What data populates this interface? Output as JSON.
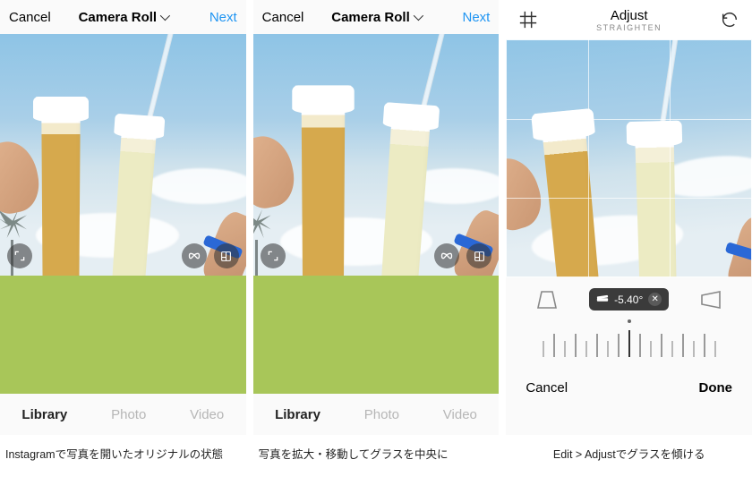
{
  "colors": {
    "accent": "#2095f2",
    "thumb_bg": "#a8c659",
    "icon_dark": "#3b3b3b"
  },
  "panels": [
    {
      "topbar": {
        "cancel": "Cancel",
        "title": "Camera Roll",
        "next": "Next"
      },
      "overlay": {
        "expand": "expand-icon",
        "infinity": "infinity-icon",
        "collage": "collage-icon"
      },
      "tabs": {
        "library": "Library",
        "photo": "Photo",
        "video": "Video",
        "active": "library"
      },
      "caption": "Instagramで写真を開いたオリジナルの状態"
    },
    {
      "topbar": {
        "cancel": "Cancel",
        "title": "Camera Roll",
        "next": "Next"
      },
      "overlay": {
        "expand": "expand-icon",
        "infinity": "infinity-icon",
        "collage": "collage-icon"
      },
      "tabs": {
        "library": "Library",
        "photo": "Photo",
        "video": "Video",
        "active": "library"
      },
      "caption": "写真を拡大・移動してグラスを中央に"
    },
    {
      "topbar": {
        "title": "Adjust",
        "subtitle": "STRAIGHTEN"
      },
      "adjust": {
        "angle_value": "-5.40°",
        "perspective_left": "perspective-vertical-icon",
        "perspective_right": "perspective-horizontal-icon",
        "level_icon": "level-icon"
      },
      "footer": {
        "cancel": "Cancel",
        "done": "Done"
      },
      "caption": "Edit > Adjustでグラスを傾ける"
    }
  ]
}
